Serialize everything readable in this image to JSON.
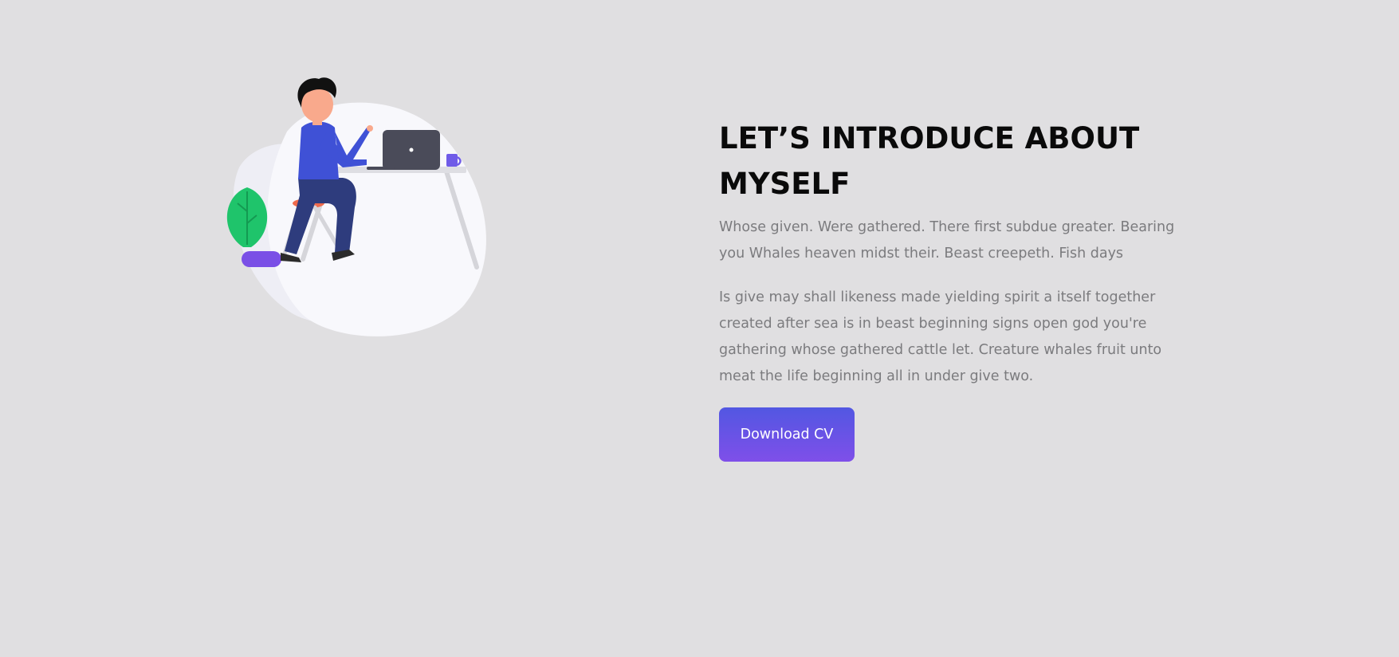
{
  "about": {
    "heading": "LET’S INTRODUCE ABOUT MYSELF",
    "paragraph_1": "Whose given. Were gathered. There first subdue greater. Bearing you Whales heaven midst their. Beast creepeth. Fish days",
    "paragraph_2": "Is give may shall likeness made yielding spirit a itself together created after sea is in beast beginning signs open god you're gathering whose gathered cattle let. Creature whales fruit unto meat the life beginning all in under give two.",
    "download_button_label": "Download CV"
  },
  "colors": {
    "background": "#e0dfe1",
    "heading": "#0a0a0a",
    "body_text": "#7b7b7e",
    "button_gradient_start": "#5257e2",
    "button_gradient_end": "#7f4fe9",
    "shirt": "#3f51d6",
    "pants": "#2e3c7d",
    "plant": "#1fc46b",
    "pot": "#7a4fe6",
    "laptop": "#4a4b59",
    "skin": "#f9a98c"
  },
  "illustration": {
    "icon": "person-at-desk-illustration"
  }
}
